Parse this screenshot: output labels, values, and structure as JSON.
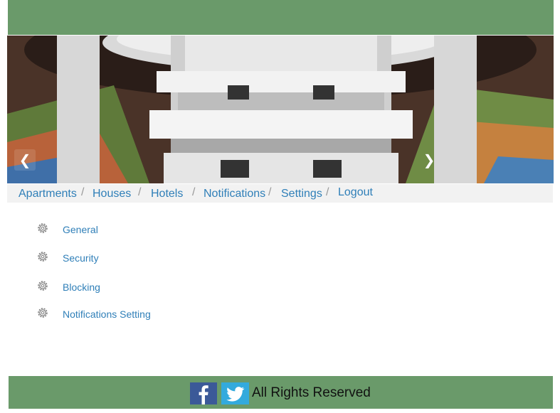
{
  "nav": {
    "items": [
      "Apartments",
      "Houses",
      "Hotels",
      "Notifications",
      "Settings",
      "Logout"
    ],
    "separator": "/"
  },
  "slider": {
    "prev": "❮",
    "next": "❯"
  },
  "settings_menu": {
    "items": [
      "General",
      "Security",
      "Blocking",
      "Notifications Setting"
    ],
    "icon": "gear-icon"
  },
  "footer": {
    "text": "All Rights Reserved",
    "social": [
      "facebook-icon",
      "twitter-icon"
    ]
  },
  "colors": {
    "header": "#6a9a6a",
    "link": "#2f7fb8",
    "nav_bg": "#f2f2f2"
  }
}
